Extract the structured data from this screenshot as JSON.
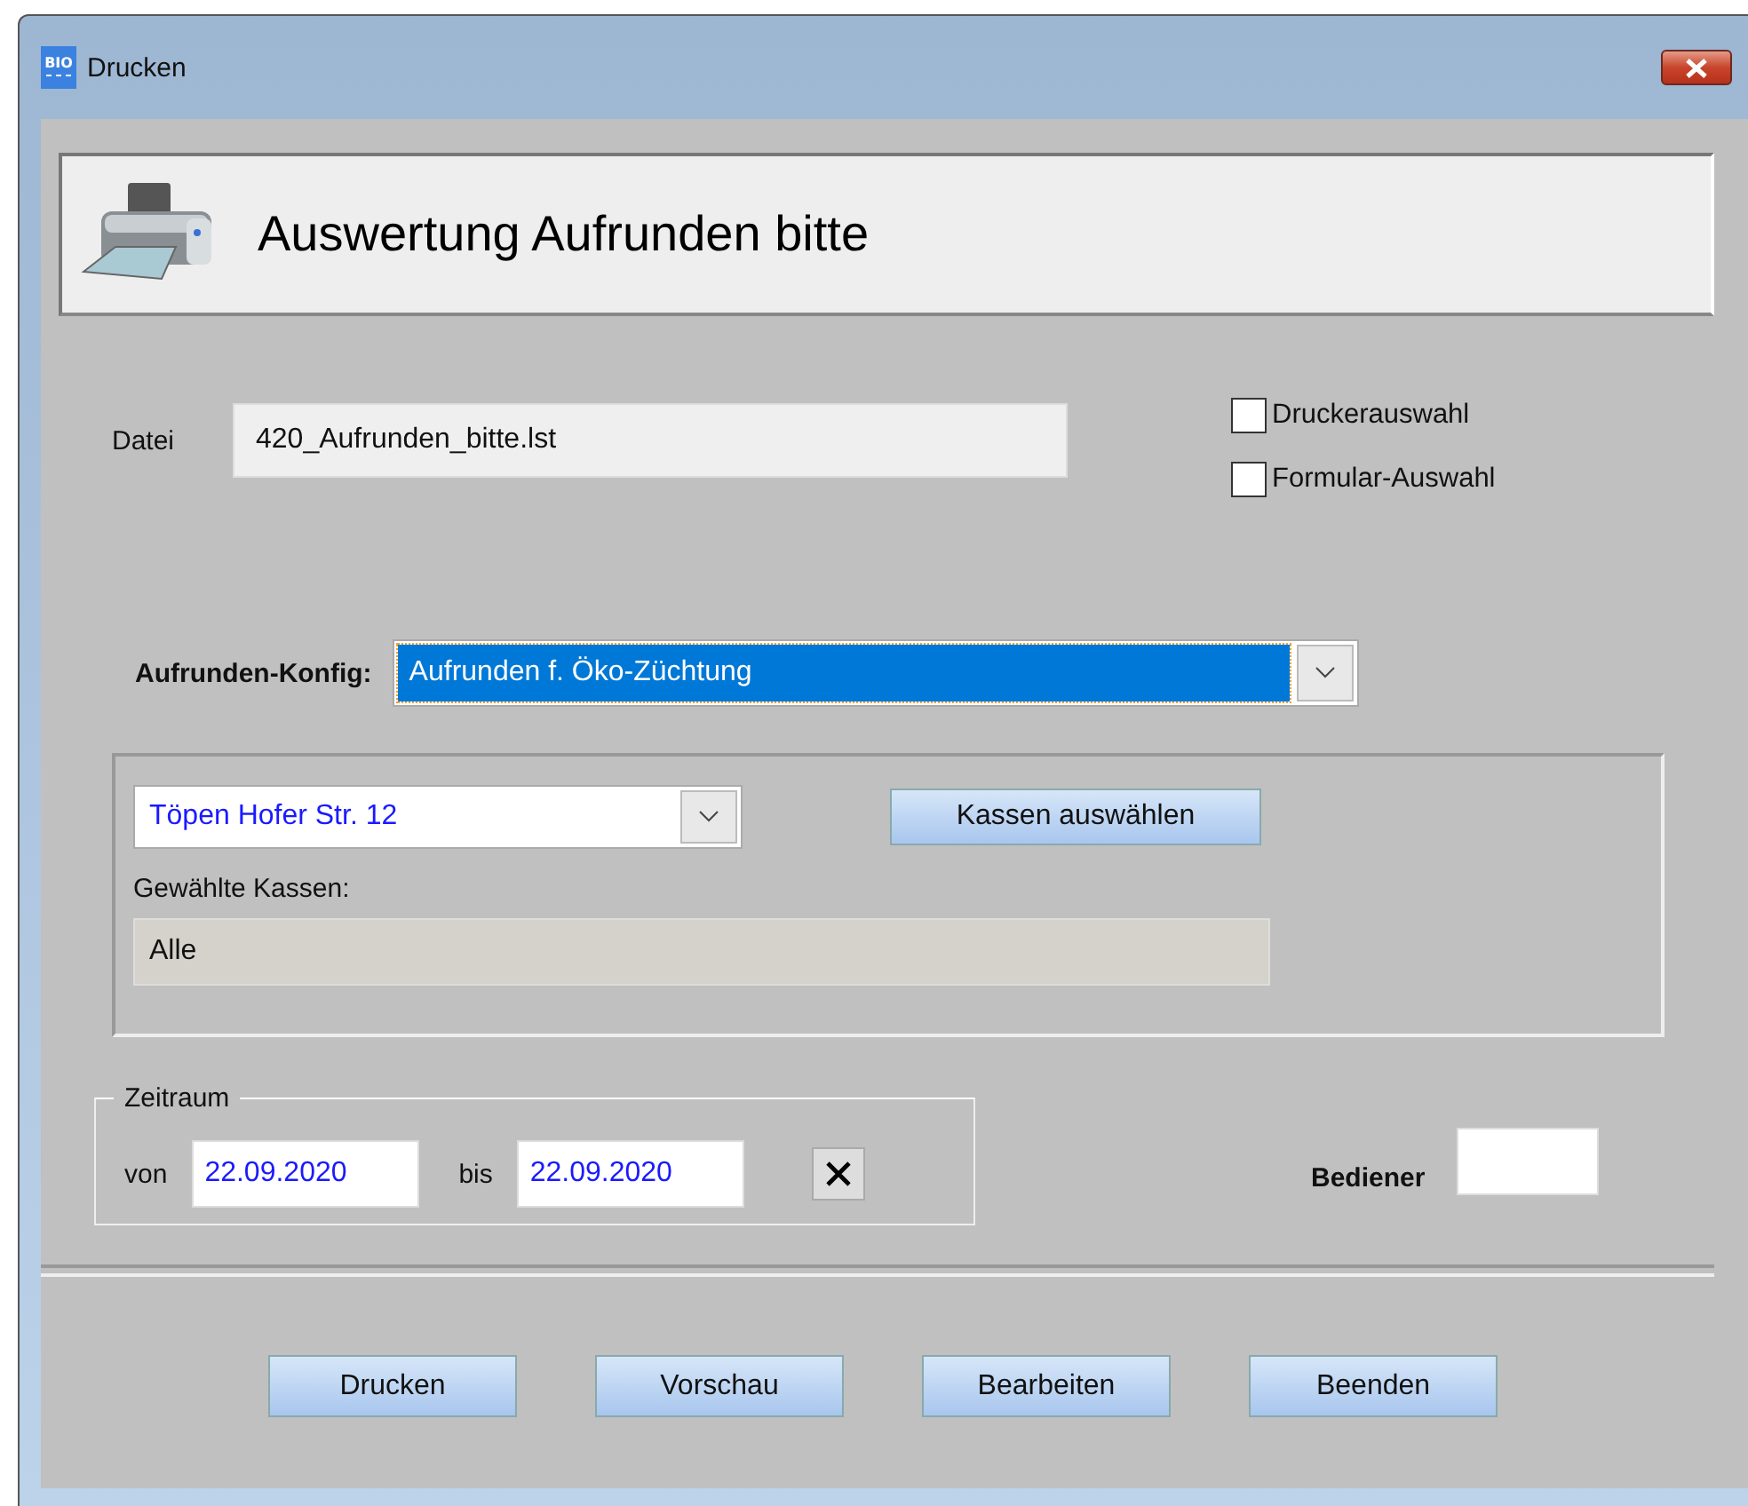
{
  "window": {
    "title": "Drucken",
    "logo_text": [
      "BIO"
    ]
  },
  "header": {
    "title": "Auswertung Aufrunden bitte"
  },
  "file": {
    "label": "Datei",
    "value": "420_Aufrunden_bitte.lst"
  },
  "options": [
    {
      "label": "Druckerauswahl",
      "checked": false
    },
    {
      "label": "Formular-Auswahl",
      "checked": false
    }
  ],
  "config": {
    "label": "Aufrunden-Konfig:",
    "value": "Aufrunden f. Öko-Züchtung"
  },
  "store": {
    "value": "Töpen Hofer Str. 12",
    "button": "Kassen auswählen",
    "selected_label": "Gewählte Kassen:",
    "selected_value": "Alle"
  },
  "period": {
    "title": "Zeitraum",
    "from_label": "von",
    "from": "22.09.2020",
    "to_label": "bis",
    "to": "22.09.2020"
  },
  "operator": {
    "label": "Bediener"
  },
  "buttons": [
    "Drucken",
    "Vorschau",
    "Bearbeiten",
    "Beenden"
  ]
}
